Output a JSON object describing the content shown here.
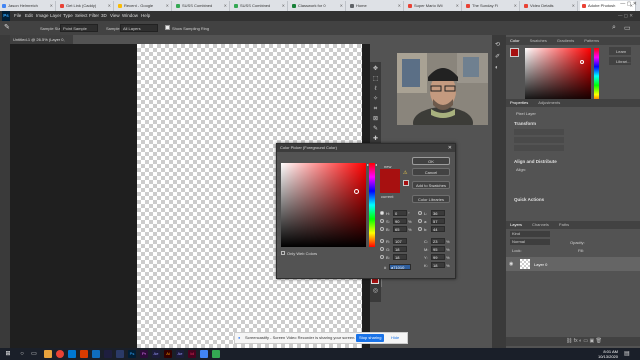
{
  "browser_tabs": [
    {
      "title": "Jason Helmreich",
      "color": "#4285f4"
    },
    {
      "title": "Get Link (Caddy)",
      "color": "#e94235"
    },
    {
      "title": "Recent - Google",
      "color": "#fbbc04"
    },
    {
      "title": "SUSS Combined",
      "color": "#34a853"
    },
    {
      "title": "SUSS Combined",
      "color": "#34a853"
    },
    {
      "title": "Classwork for 0",
      "color": "#188038"
    },
    {
      "title": "Home",
      "color": "#5f6368"
    },
    {
      "title": "Super Mario Wii",
      "color": "#e94235"
    },
    {
      "title": "The Sunday Fi",
      "color": "#e94235"
    },
    {
      "title": "Video Details",
      "color": "#e94235"
    },
    {
      "title": "Adobe Photosh",
      "color": "#ea4335"
    }
  ],
  "menubar": {
    "logo": "Ps",
    "items": [
      "File",
      "Edit",
      "Image",
      "Layer",
      "Type",
      "Select",
      "Filter",
      "3D",
      "View",
      "Window",
      "Help"
    ]
  },
  "options": {
    "sample_size_label": "Sample Size:",
    "sample_size_value": "Point Sample",
    "sample_label": "Sample:",
    "sample_value": "All Layers",
    "show_ring_label": "Show Sampling Ring"
  },
  "document_tab": "Untitled-1 @ 26.5% (Layer 0, RGB/8) *",
  "panels": {
    "color_tabs": [
      "Color",
      "Swatches",
      "Gradients",
      "Patterns"
    ],
    "learn_label": "Learn",
    "libraries_label": "Librari...",
    "properties_tabs": [
      "Properties",
      "Adjustments"
    ],
    "pixel_layer": "Pixel Layer",
    "transform": "Transform",
    "align": "Align and Distribute",
    "align_sub": "Align:",
    "quick_actions": "Quick Actions",
    "layers_tabs": [
      "Layers",
      "Channels",
      "Paths"
    ],
    "kind": "Kind",
    "blend_mode": "Normal",
    "opacity_label": "Opacity:",
    "lock_label": "Lock:",
    "fill_label": "Fill:",
    "layer_name": "Layer 0"
  },
  "dialog": {
    "title": "Color Picker (Foreground Color)",
    "new_label": "new",
    "current_label": "current",
    "ok": "OK",
    "cancel": "Cancel",
    "add_swatches": "Add to Swatches",
    "color_libraries": "Color Libraries",
    "only_web_colors": "Only Web Colors",
    "fields": {
      "H": "0",
      "S": "90",
      "B": "65",
      "R": "107",
      "G": "18",
      "Bb": "18",
      "L": "36",
      "a": "57",
      "b": "44",
      "C": "23",
      "M": "95",
      "Y": "99",
      "K": "18",
      "hex": "a71010"
    },
    "units": {
      "H": "°",
      "S": "%",
      "B": "%",
      "C": "%",
      "M": "%",
      "Y": "%",
      "K": "%"
    },
    "new_color": "#a71010",
    "current_color": "#a71010"
  },
  "notification": {
    "text": "Screencastify - Screen Video Recorder is sharing your screen.",
    "stop_button": "Stop sharing",
    "hide": "Hide"
  },
  "taskbar": {
    "time": "8:01 AM",
    "date": "10/13/2020"
  }
}
